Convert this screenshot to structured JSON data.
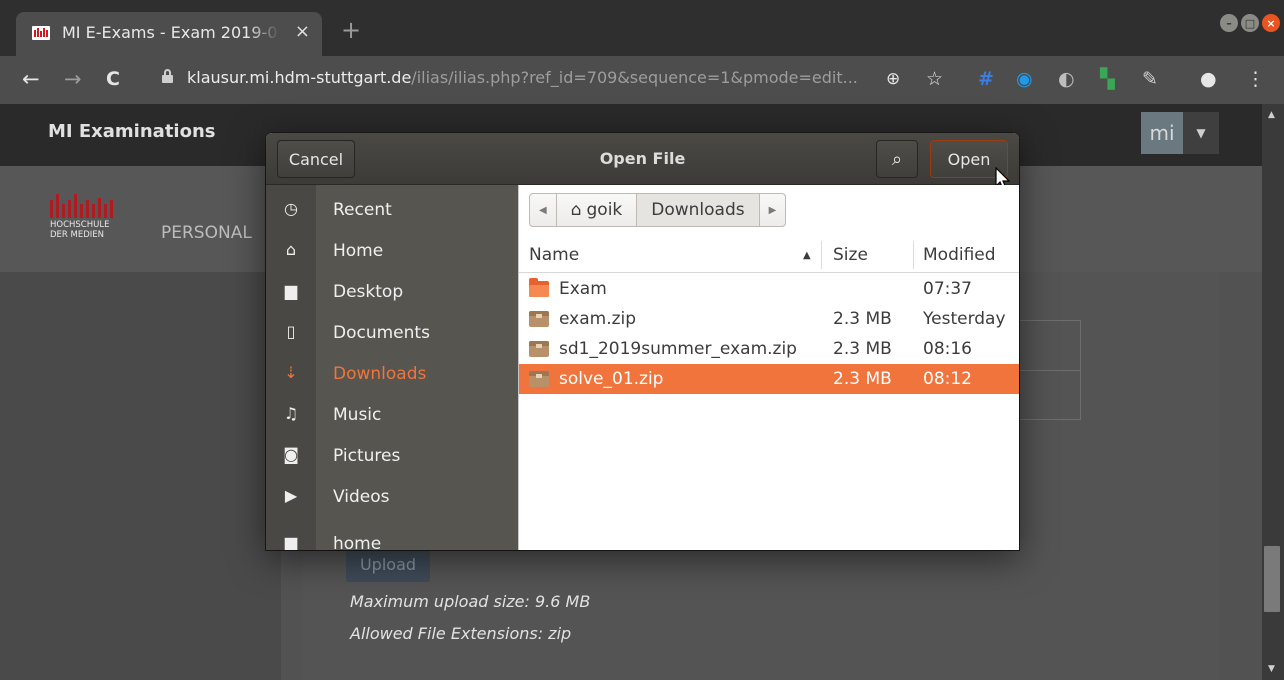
{
  "browser": {
    "tab_title": "MI E-Exams - Exam 2019-0",
    "tab_close": "×",
    "new_tab": "+",
    "url_host": "klausur.mi.hdm-stuttgart.de",
    "url_path": "/ilias/ilias.php?ref_id=709&sequence=1&pmode=edit...",
    "nav": {
      "back": "←",
      "forward": "→",
      "reload": "C"
    },
    "toolbar_icons": [
      "zoom-icon",
      "star-icon",
      "hashtag-extension-icon",
      "sync-extension-icon",
      "privacy-extension-icon",
      "google-extension-icon",
      "eyedropper-extension-icon",
      "account-icon",
      "menu-icon"
    ],
    "window_buttons": [
      "minimize",
      "maximize",
      "close"
    ]
  },
  "page": {
    "brand": "MI Examinations",
    "avatar": "mi",
    "logo_line1": "HOCHSCHULE",
    "logo_line2": "DER MEDIEN",
    "nav_item": "PERSONAL",
    "upload_button": "Upload",
    "max_upload": "Maximum upload size: 9.6 MB",
    "allowed_ext": "Allowed File Extensions: zip"
  },
  "dialog": {
    "title": "Open File",
    "cancel": "Cancel",
    "open": "Open",
    "sidebar": [
      {
        "label": "Recent",
        "icon": "clock-icon",
        "glyph": "◷"
      },
      {
        "label": "Home",
        "icon": "home-icon",
        "glyph": "⌂"
      },
      {
        "label": "Desktop",
        "icon": "desktop-folder-icon",
        "glyph": "▆"
      },
      {
        "label": "Documents",
        "icon": "document-icon",
        "glyph": "▯"
      },
      {
        "label": "Downloads",
        "icon": "download-icon",
        "glyph": "⇣",
        "active": true
      },
      {
        "label": "Music",
        "icon": "music-icon",
        "glyph": "♫"
      },
      {
        "label": "Pictures",
        "icon": "camera-icon",
        "glyph": "◙"
      },
      {
        "label": "Videos",
        "icon": "video-icon",
        "glyph": "▶"
      }
    ],
    "sidebar_partial": {
      "label": "home",
      "glyph": "▆"
    },
    "path": [
      "goik",
      "Downloads"
    ],
    "columns": {
      "name": "Name",
      "size": "Size",
      "modified": "Modified"
    },
    "files": [
      {
        "name": "Exam",
        "type": "folder",
        "size": "",
        "modified": "07:37"
      },
      {
        "name": "exam.zip",
        "type": "zip",
        "size": "2.3 MB",
        "modified": "Yesterday"
      },
      {
        "name": "sd1_2019summer_exam.zip",
        "type": "zip",
        "size": "2.3 MB",
        "modified": "08:16"
      },
      {
        "name": "solve_01.zip",
        "type": "zip",
        "size": "2.3 MB",
        "modified": "08:12",
        "selected": true
      }
    ],
    "colors": {
      "accent": "#f0743c",
      "header": "#3c3b37",
      "sidebar": "#57554f"
    }
  }
}
